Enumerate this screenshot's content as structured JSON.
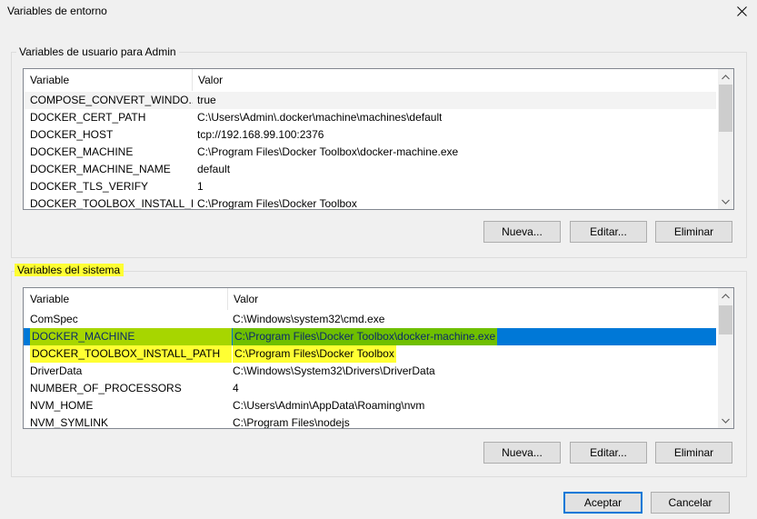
{
  "window": {
    "title": "Variables de entorno",
    "close_icon": "close-icon"
  },
  "user_group": {
    "label": "Variables de usuario para Admin",
    "columns": [
      "Variable",
      "Valor"
    ],
    "rows": [
      {
        "name": "COMPOSE_CONVERT_WINDO...",
        "value": "true"
      },
      {
        "name": "DOCKER_CERT_PATH",
        "value": "C:\\Users\\Admin\\.docker\\machine\\machines\\default"
      },
      {
        "name": "DOCKER_HOST",
        "value": "tcp://192.168.99.100:2376"
      },
      {
        "name": "DOCKER_MACHINE",
        "value": "C:\\Program Files\\Docker Toolbox\\docker-machine.exe"
      },
      {
        "name": "DOCKER_MACHINE_NAME",
        "value": "default"
      },
      {
        "name": "DOCKER_TLS_VERIFY",
        "value": "1"
      },
      {
        "name": "DOCKER_TOOLBOX_INSTALL_P...",
        "value": "C:\\Program Files\\Docker Toolbox"
      }
    ],
    "buttons": {
      "new": "Nueva...",
      "edit": "Editar...",
      "delete": "Eliminar"
    }
  },
  "system_group": {
    "label": "Variables del sistema",
    "columns": [
      "Variable",
      "Valor"
    ],
    "rows": [
      {
        "name": "ComSpec",
        "value": "C:\\Windows\\system32\\cmd.exe"
      },
      {
        "name": "DOCKER_MACHINE",
        "value": "C:\\Program Files\\Docker Toolbox\\docker-machine.exe"
      },
      {
        "name": "DOCKER_TOOLBOX_INSTALL_PATH",
        "value": "C:\\Program Files\\Docker Toolbox"
      },
      {
        "name": "DriverData",
        "value": "C:\\Windows\\System32\\Drivers\\DriverData"
      },
      {
        "name": "NUMBER_OF_PROCESSORS",
        "value": "4"
      },
      {
        "name": "NVM_HOME",
        "value": "C:\\Users\\Admin\\AppData\\Roaming\\nvm"
      },
      {
        "name": "NVM_SYMLINK",
        "value": "C:\\Program Files\\nodejs"
      }
    ],
    "buttons": {
      "new": "Nueva...",
      "edit": "Editar...",
      "delete": "Eliminar"
    }
  },
  "footer": {
    "ok": "Aceptar",
    "cancel": "Cancelar"
  },
  "colors": {
    "selection": "#0078d7",
    "highlight_yellow": "#ffff33",
    "highlight_green": "#a7d600"
  }
}
